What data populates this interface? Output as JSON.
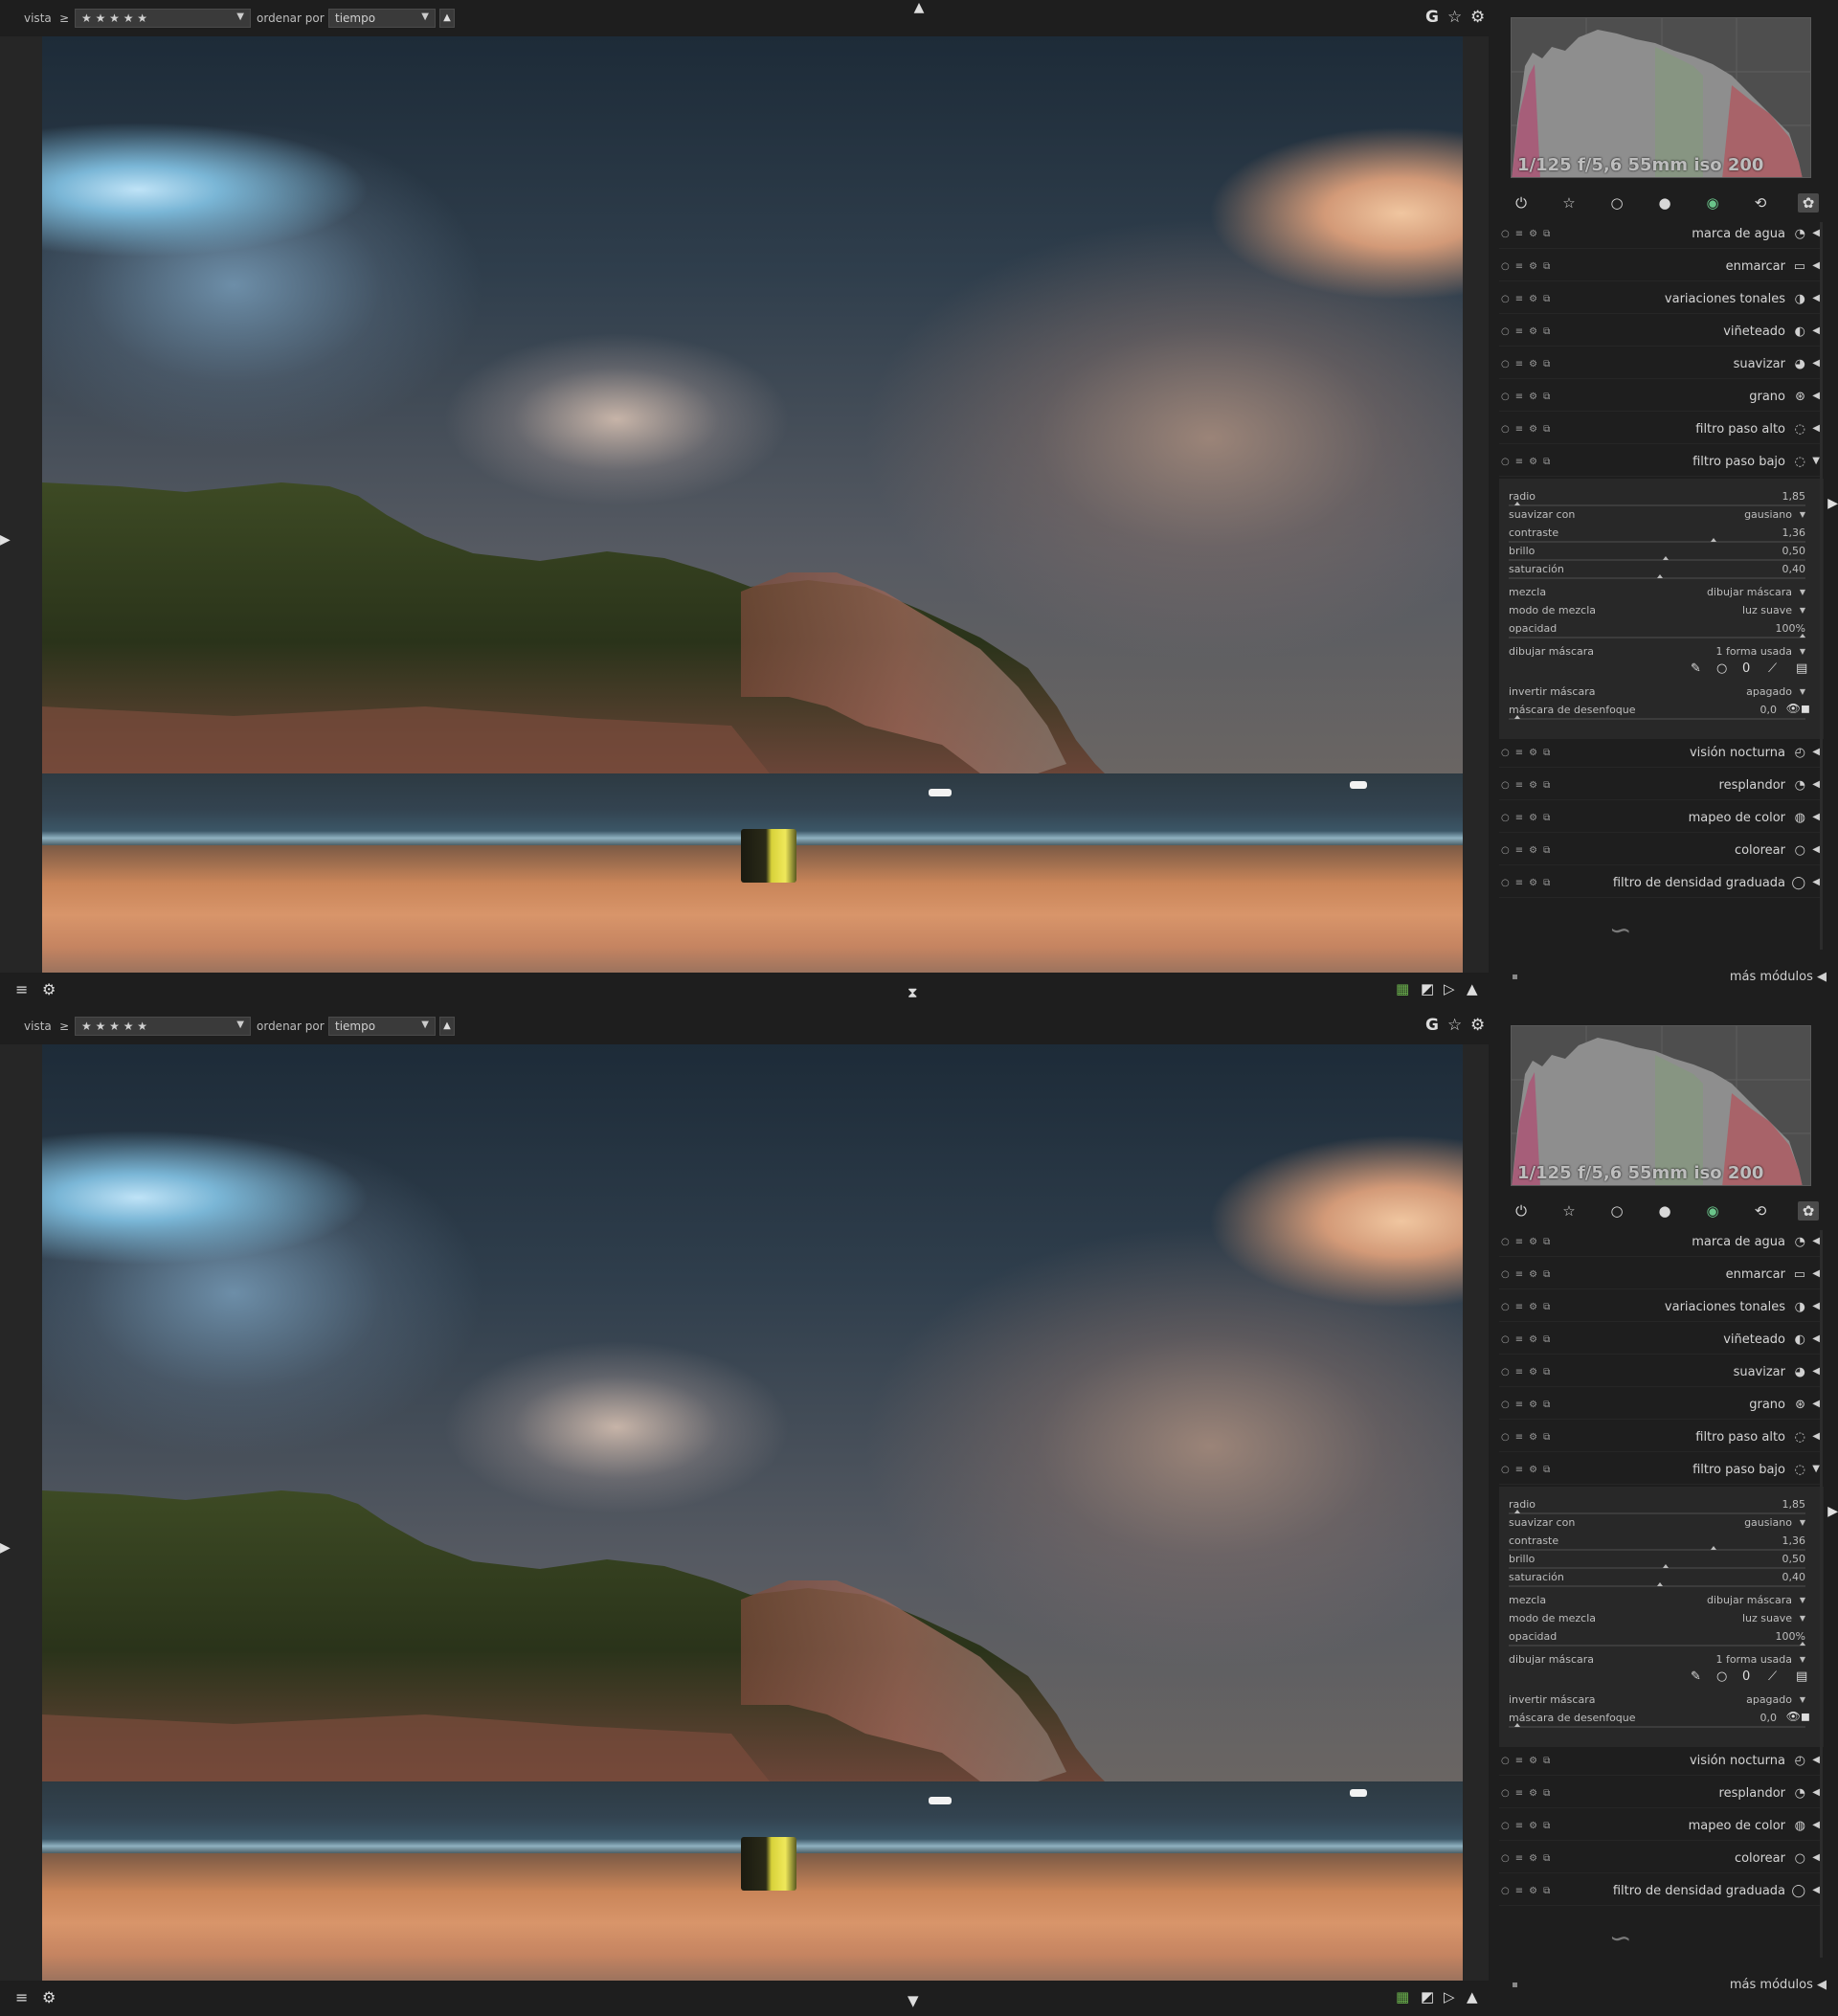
{
  "panels": [
    {
      "toolbar": {
        "view_label": "vista",
        "rating_op": "≥",
        "rating_stars": "★ ★ ★ ★ ★",
        "sort_label": "ordenar por",
        "sort_value": "tiempo",
        "sort_dir": "▲",
        "grouping": "G"
      },
      "histogram": {
        "exif": "1/125 f/5,6 55mm iso 200"
      },
      "modules": [
        {
          "name": "marca de agua",
          "icon": "watermark-icon"
        },
        {
          "name": "enmarcar",
          "icon": "frame-icon"
        },
        {
          "name": "variaciones tonales",
          "icon": "split-toning-icon"
        },
        {
          "name": "viñeteado",
          "icon": "vignette-icon"
        },
        {
          "name": "suavizar",
          "icon": "soften-icon"
        },
        {
          "name": "grano",
          "icon": "grain-icon"
        },
        {
          "name": "filtro paso alto",
          "icon": "highpass-icon"
        },
        {
          "name": "filtro paso bajo",
          "icon": "lowpass-icon",
          "expanded": true
        }
      ],
      "params": {
        "radio_label": "radio",
        "radio_value": "1,85",
        "suavizar_label": "suavizar con",
        "suavizar_value": "gausiano",
        "contraste_label": "contraste",
        "contraste_value": "1,36",
        "brillo_label": "brillo",
        "brillo_value": "0,50",
        "saturacion_label": "saturación",
        "saturacion_value": "0,40",
        "mezcla_label": "mezcla",
        "mezcla_value": "dibujar máscara",
        "modo_label": "modo de mezcla",
        "modo_value": "luz suave",
        "opacidad_label": "opacidad",
        "opacidad_value": "100%",
        "dibujar_label": "dibujar máscara",
        "dibujar_value": "1 forma usada",
        "invertir_label": "invertir máscara",
        "invertir_value": "apagado",
        "desenfoque_label": "máscara de desenfoque",
        "desenfoque_value": "0,0"
      },
      "modules_after": [
        {
          "name": "visión nocturna",
          "icon": "lowlight-icon"
        },
        {
          "name": "resplandor",
          "icon": "bloom-icon"
        },
        {
          "name": "mapeo de color",
          "icon": "colormapping-icon"
        },
        {
          "name": "colorear",
          "icon": "colorize-icon"
        },
        {
          "name": "filtro de densidad graduada",
          "icon": "graduated-density-icon"
        }
      ],
      "more_modules": "más módulos"
    },
    {
      "toolbar": {
        "view_label": "vista",
        "rating_op": "≥",
        "rating_stars": "★ ★ ★ ★ ★",
        "sort_label": "ordenar por",
        "sort_value": "tiempo",
        "sort_dir": "▲",
        "grouping": "G"
      },
      "histogram": {
        "exif": "1/125 f/5,6 55mm iso 200"
      },
      "modules": [
        {
          "name": "marca de agua",
          "icon": "watermark-icon"
        },
        {
          "name": "enmarcar",
          "icon": "frame-icon"
        },
        {
          "name": "variaciones tonales",
          "icon": "split-toning-icon"
        },
        {
          "name": "viñeteado",
          "icon": "vignette-icon"
        },
        {
          "name": "suavizar",
          "icon": "soften-icon"
        },
        {
          "name": "grano",
          "icon": "grain-icon"
        },
        {
          "name": "filtro paso alto",
          "icon": "highpass-icon"
        },
        {
          "name": "filtro paso bajo",
          "icon": "lowpass-icon",
          "expanded": true
        }
      ],
      "params": {
        "radio_label": "radio",
        "radio_value": "1,85",
        "suavizar_label": "suavizar con",
        "suavizar_value": "gausiano",
        "contraste_label": "contraste",
        "contraste_value": "1,36",
        "brillo_label": "brillo",
        "brillo_value": "0,50",
        "saturacion_label": "saturación",
        "saturacion_value": "0,40",
        "mezcla_label": "mezcla",
        "mezcla_value": "dibujar máscara",
        "modo_label": "modo de mezcla",
        "modo_value": "luz suave",
        "opacidad_label": "opacidad",
        "opacidad_value": "100%",
        "dibujar_label": "dibujar máscara",
        "dibujar_value": "1 forma usada",
        "invertir_label": "invertir máscara",
        "invertir_value": "apagado",
        "desenfoque_label": "máscara de desenfoque",
        "desenfoque_value": "0,0"
      },
      "modules_after": [
        {
          "name": "visión nocturna",
          "icon": "lowlight-icon"
        },
        {
          "name": "resplandor",
          "icon": "bloom-icon"
        },
        {
          "name": "mapeo de color",
          "icon": "colormapping-icon"
        },
        {
          "name": "colorear",
          "icon": "colorize-icon"
        },
        {
          "name": "filtro de densidad graduada",
          "icon": "graduated-density-icon"
        }
      ],
      "more_modules": "más módulos"
    }
  ],
  "colors": {
    "background": "#1e1e1e",
    "panel": "#282828",
    "text": "#d4d4d4"
  }
}
